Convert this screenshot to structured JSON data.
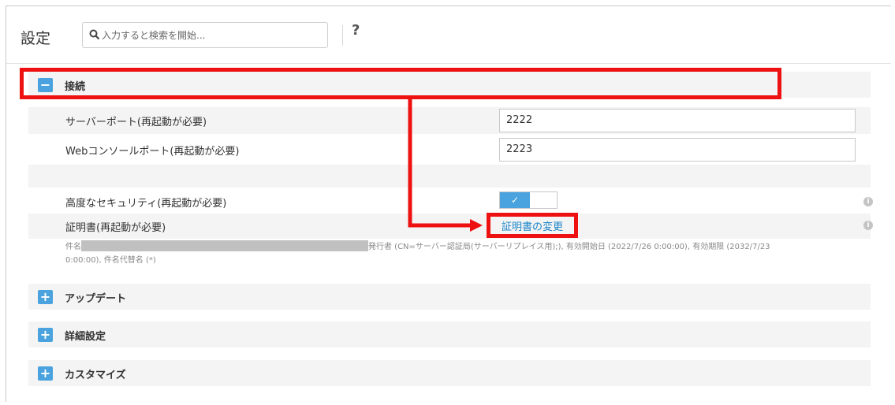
{
  "header": {
    "title": "設定",
    "search_placeholder": "入力すると検索を開始...",
    "help": "?"
  },
  "sections": {
    "connection": {
      "toggle": "−",
      "label": "接続",
      "server_port_label": "サーバーポート(再起動が必要)",
      "server_port_value": "2222",
      "web_console_port_label": "Webコンソールポート(再起動が必要)",
      "web_console_port_value": "2223",
      "advanced_security_label": "高度なセキュリティ(再起動が必要)",
      "advanced_security_state": "✓",
      "certificate_label": "証明書(再起動が必要)",
      "certificate_change_link": "証明書の変更",
      "certificate_subject_prefix": "件名",
      "certificate_details_line1": "発行者 (CN=サーバー認証局(サーバーリプレイス用);), 有効開始日 (2022/7/26 0:00:00), 有効期限 (2032/7/23",
      "certificate_details_line2": "0:00:00), 件名代替名 (*)",
      "info_icon": "i"
    },
    "update": {
      "toggle": "+",
      "label": "アップデート"
    },
    "advanced": {
      "toggle": "+",
      "label": "詳細設定"
    },
    "customize": {
      "toggle": "+",
      "label": "カスタマイズ"
    }
  },
  "colors": {
    "accent": "#4aa3de",
    "link": "#1a84c7",
    "highlight": "#ee1111"
  },
  "icons": {
    "search": "search-icon",
    "info": "info-icon",
    "arrow": "arrow-annotation"
  }
}
